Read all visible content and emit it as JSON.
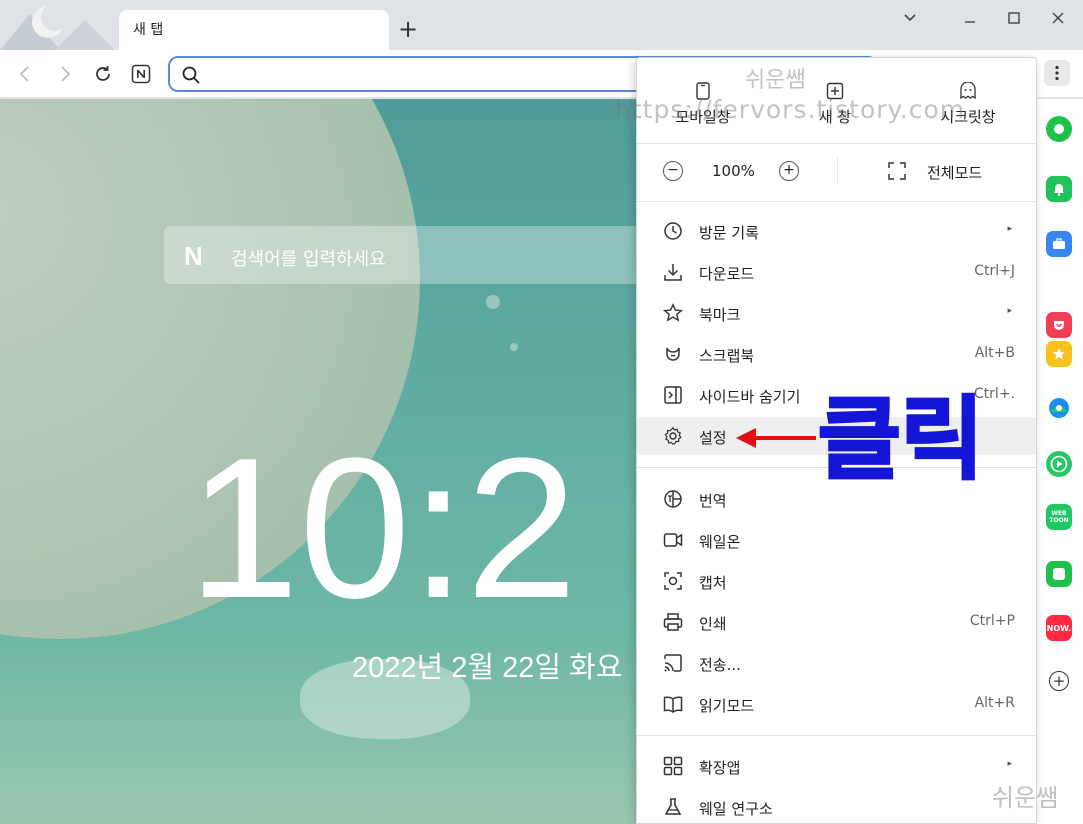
{
  "tab": {
    "title": "새 탭",
    "new_tab_symbol": "+"
  },
  "toolbar": {
    "address_value": ""
  },
  "newtab": {
    "search_logo": "N",
    "search_placeholder": "검색어를 입력하세요",
    "clock": "10:2",
    "date": "2022년 2월 22일 화요"
  },
  "menu": {
    "top": [
      {
        "label": "모바일창"
      },
      {
        "label": "새 창"
      },
      {
        "label": "시크릿창"
      }
    ],
    "zoom": {
      "minus": "−",
      "value": "100%",
      "plus": "+",
      "fullscreen_label": "전체모드"
    },
    "items": [
      {
        "label": "방문 기록",
        "shortcut": "",
        "submenu": "▸",
        "icon": "history-icon"
      },
      {
        "label": "다운로드",
        "shortcut": "Ctrl+J",
        "submenu": "",
        "icon": "download-icon"
      },
      {
        "label": "북마크",
        "shortcut": "",
        "submenu": "▸",
        "icon": "star-icon"
      },
      {
        "label": "스크랩북",
        "shortcut": "Alt+B",
        "submenu": "",
        "icon": "scrapbook-icon"
      },
      {
        "label": "사이드바 숨기기",
        "shortcut": "Ctrl+.",
        "submenu": "",
        "icon": "sidebar-hide-icon"
      },
      {
        "label": "설정",
        "shortcut": "",
        "submenu": "",
        "icon": "gear-icon",
        "highlighted": true
      },
      {
        "label": "번역",
        "shortcut": "",
        "submenu": "",
        "icon": "translate-icon"
      },
      {
        "label": "웨일온",
        "shortcut": "",
        "submenu": "",
        "icon": "video-call-icon"
      },
      {
        "label": "캡처",
        "shortcut": "",
        "submenu": "",
        "icon": "capture-icon"
      },
      {
        "label": "인쇄",
        "shortcut": "Ctrl+P",
        "submenu": "",
        "icon": "print-icon"
      },
      {
        "label": "전송...",
        "shortcut": "",
        "submenu": "",
        "icon": "cast-icon"
      },
      {
        "label": "읽기모드",
        "shortcut": "Alt+R",
        "submenu": "",
        "icon": "reading-mode-icon"
      },
      {
        "label": "확장앱",
        "shortcut": "",
        "submenu": "▸",
        "icon": "extensions-icon"
      },
      {
        "label": "웨일 연구소",
        "shortcut": "",
        "submenu": "",
        "icon": "labs-icon"
      }
    ]
  },
  "sidebar": {
    "apps": [
      {
        "name": "green-circle-app-icon",
        "color": "#1ec24a",
        "glyph": ""
      },
      {
        "name": "bell-icon",
        "color": "#21c25a",
        "glyph": ""
      },
      {
        "name": "briefcase-icon",
        "color": "#3a86f0",
        "glyph": ""
      },
      {
        "name": "pocket-icon",
        "color": "#ef4056",
        "glyph": ""
      },
      {
        "name": "star-app-icon",
        "color": "#f7c21b",
        "glyph": ""
      },
      {
        "name": "papago-icon",
        "color": "#1d8ef0",
        "glyph": ""
      },
      {
        "name": "play-icon",
        "color": "#27c866",
        "glyph": ""
      },
      {
        "name": "webtoon-icon",
        "color": "#20c865",
        "glyph": "WEB TOON"
      },
      {
        "name": "green-square-app-icon",
        "color": "#1ec24a",
        "glyph": ""
      },
      {
        "name": "now-icon",
        "color": "#ff2a3d",
        "glyph": "NOW."
      }
    ],
    "add_symbol": "+"
  },
  "overlay": {
    "watermark_name": "쉬운쌤",
    "watermark_url": "https://fervors.tistory.com",
    "callout_text": "클릭",
    "callout_color": "#1515d8",
    "arrow_color": "#e01010"
  }
}
